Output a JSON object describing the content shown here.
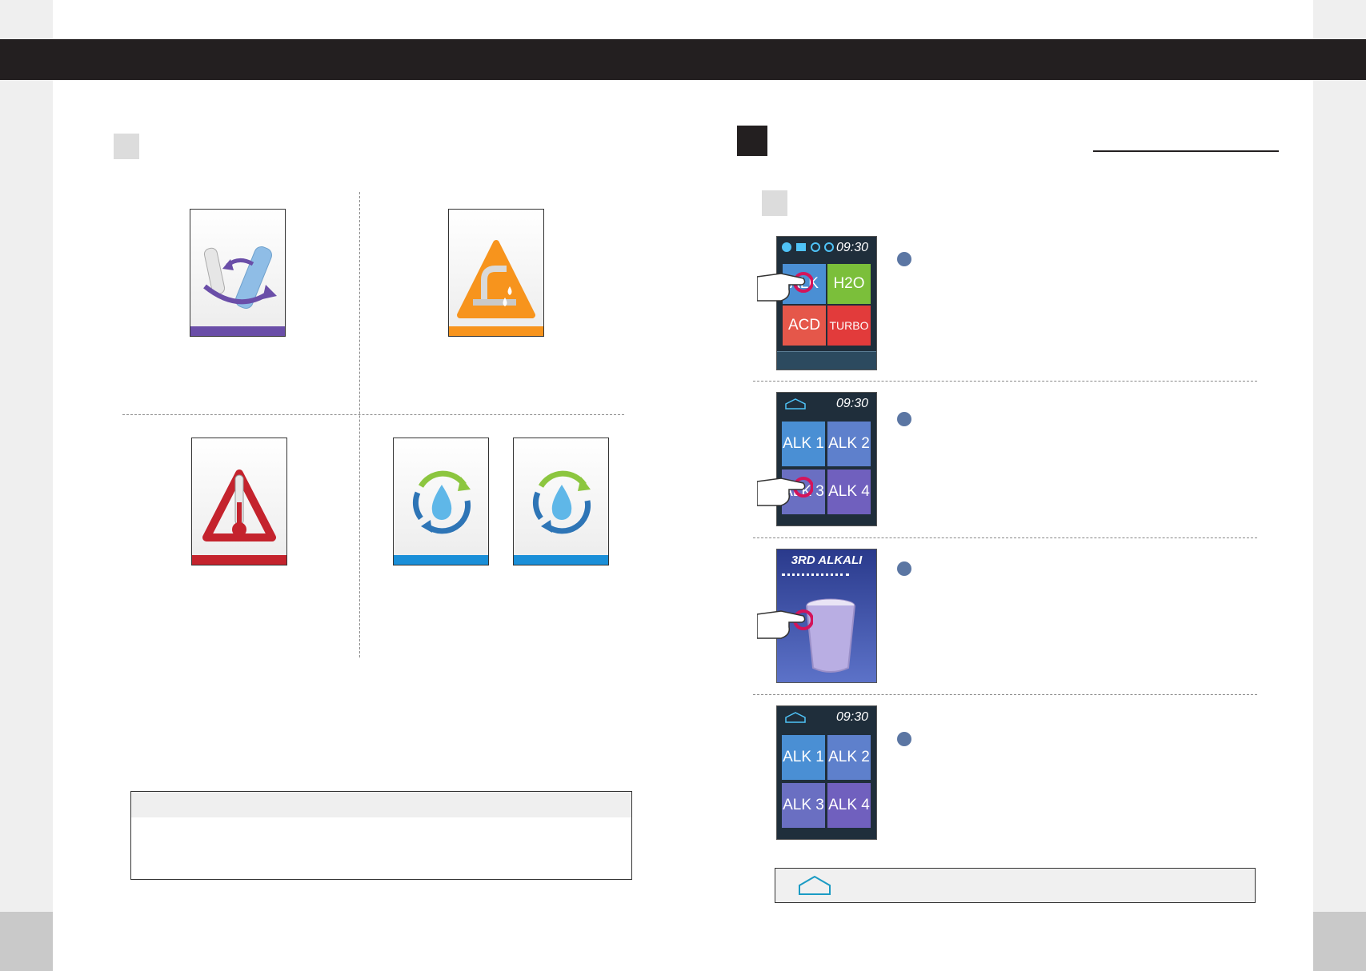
{
  "icons": {
    "filter_change": "filter-change-icon",
    "water_supply_warning": "faucet-warning-icon",
    "temperature_warning": "thermometer-warning-icon",
    "cleaning": "water-cycle-icon",
    "touch": "hand-pointer-icon",
    "home": "home-icon"
  },
  "colors": {
    "purple": "#6a4ea8",
    "orange": "#f7941d",
    "red": "#c4232d",
    "blue": "#1a8fd8"
  },
  "screens": {
    "main": {
      "time": "09:30",
      "tiles": [
        "ALK",
        "H2O",
        "ACD",
        "TURBO"
      ]
    },
    "alk_select": {
      "time": "09:30",
      "tiles": [
        "ALK 1",
        "ALK 2",
        "ALK 3",
        "ALK 4"
      ]
    },
    "dispense": {
      "title": "3RD ALKALI"
    },
    "alk_after": {
      "time": "09:30",
      "tiles": [
        "ALK 1",
        "ALK 2",
        "ALK 3",
        "ALK 4"
      ]
    }
  }
}
